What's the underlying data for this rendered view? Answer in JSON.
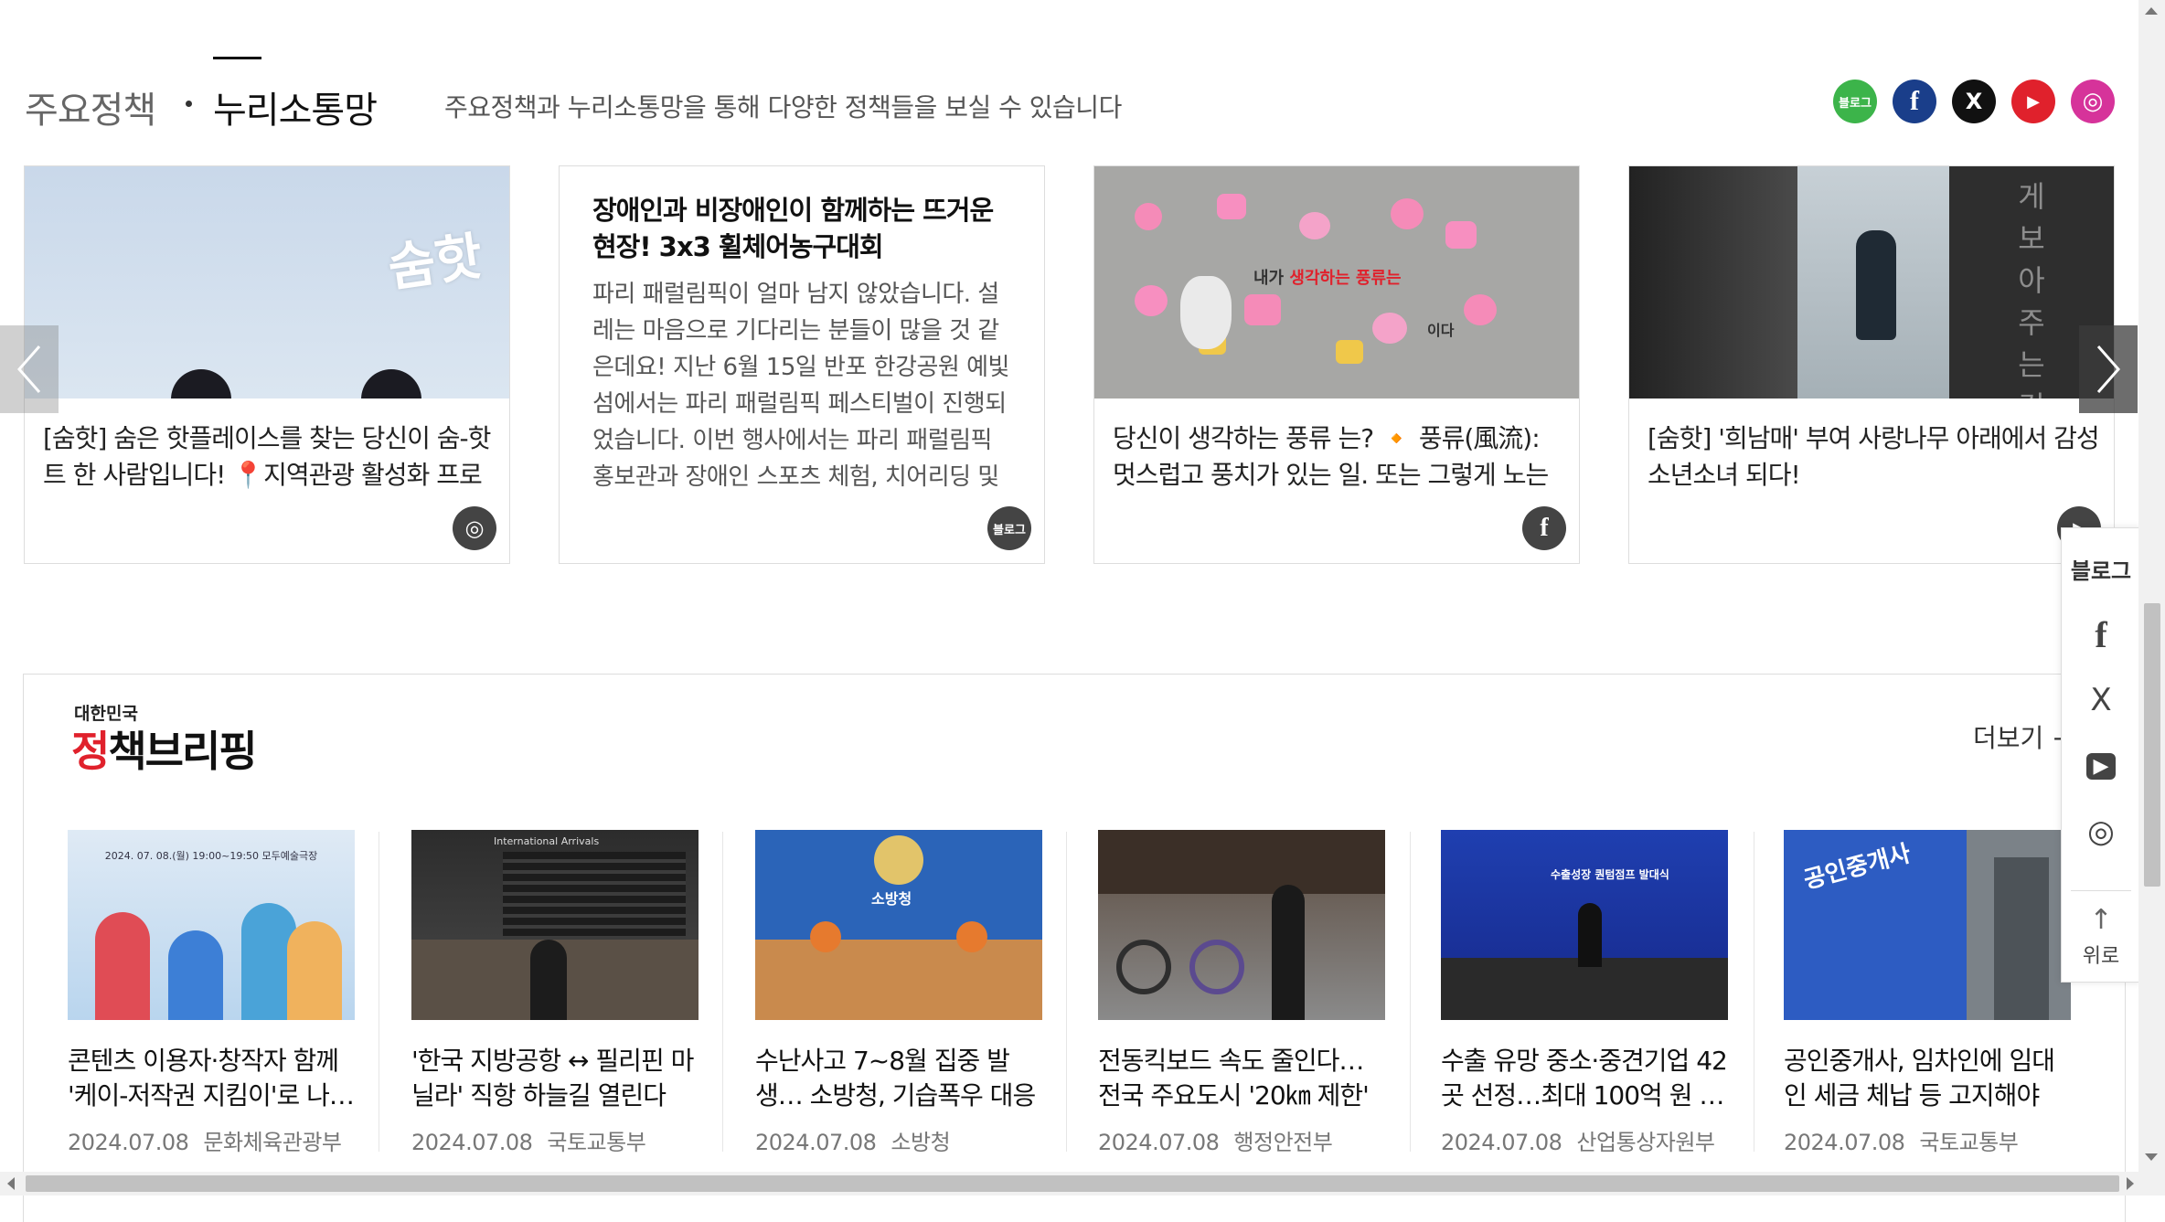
{
  "header": {
    "tab_policy": "주요정책",
    "tab_nuri": "누리소통망",
    "subtitle": "주요정책과 누리소통망을 통해 다양한 정책들을 보실 수 있습니다",
    "social": {
      "blog": "블로그",
      "facebook": "f",
      "x": "X",
      "youtube": "▶",
      "instagram": "◎"
    },
    "colors": {
      "blog": "#3cb44a",
      "facebook": "#1a3e8a",
      "x": "#111111",
      "youtube": "#e0212c",
      "instagram": "#d6339a"
    }
  },
  "cards": [
    {
      "caption": "[숨핫] 숨은 핫플레이스를 찾는 당신이 숨-핫트 한 사람입니다! 📍지역관광 활성화 프로젝트…",
      "badge": "◎",
      "img_text": "숨핫"
    },
    {
      "title": "장애인과 비장애인이 함께하는 뜨거운 현장! 3x3 휠체어농구대회",
      "body": "파리 패럴림픽이 얼마 남지 않았습니다. 설레는 마음으로 기다리는 분들이 많을 것 같은데요! 지난 6월 15일 반포 한강공원 예빛섬에서는 파리 패럴림픽 페스티벌이 진행되었습니다. 이번 행사에서는 파리 패럴림픽 홍보관과 장애인 스포츠 체험, 치어리딩 및",
      "badge": "블로그"
    },
    {
      "caption": "당신이 생각하는 풍류 는? 🔸 풍류(風流): 멋스럽고 풍치가 있는 일. 또는 그렇게 노는 일. 사…",
      "badge": "f",
      "img_text_a": "내가",
      "img_text_b": "생각하는 풍류는",
      "img_text_c": "이다"
    },
    {
      "caption": "[숨핫] '희남매' 부여 사랑나무 아래에서 감성소년소녀 되다!",
      "badge": "▶",
      "img_text": "게 보 아 주 는 것 이"
    }
  ],
  "floatbar": {
    "blog": "블로그",
    "facebook": "f",
    "x": "X",
    "youtube": "▶",
    "instagram": "◎",
    "top_arrow": "↑",
    "top_label": "위로"
  },
  "briefing": {
    "logo_small": "대한민국",
    "logo_big_1": "정",
    "logo_big_2": "책브리핑",
    "more": "더보기 +",
    "items": [
      {
        "title": "콘텐츠 이용자·창작자 함께 '케이-저작권 지킴이'로 나…",
        "date": "2024.07.08",
        "dept": "문화체육관광부",
        "img_text": "2024. 07. 08.(월) 19:00~19:50  모두예술극장"
      },
      {
        "title": "'한국 지방공항 ↔ 필리핀 마닐라' 직항 하늘길 열린다",
        "date": "2024.07.08",
        "dept": "국토교통부",
        "img_text": "International Arrivals"
      },
      {
        "title": "수난사고 7~8월 집중 발생… 소방청, 기습폭우 대응 강화",
        "date": "2024.07.08",
        "dept": "소방청",
        "img_text": "소방청"
      },
      {
        "title": "전동킥보드 속도 줄인다…전국 주요도시 '20㎞ 제한' …",
        "date": "2024.07.08",
        "dept": "행정안전부",
        "img_text": ""
      },
      {
        "title": "수출 유망 중소·중견기업 42곳 선정…최대 100억 원 …",
        "date": "2024.07.08",
        "dept": "산업통상자원부",
        "img_text": "수출성장 퀀텀점프 발대식"
      },
      {
        "title": "공인중개사, 임차인에 임대인 세금 체납 등 고지해야",
        "date": "2024.07.08",
        "dept": "국토교통부",
        "img_text": "공인중개사"
      }
    ]
  }
}
